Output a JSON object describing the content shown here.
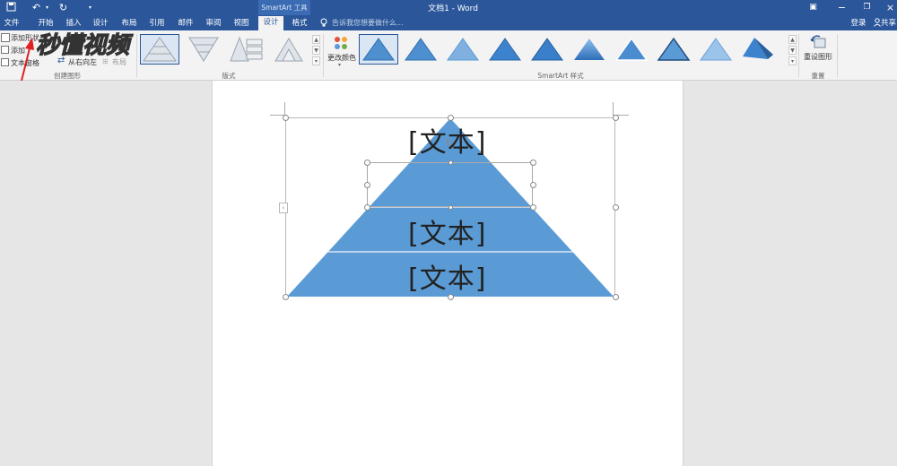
{
  "window": {
    "title": "文档1 - Word",
    "context_tool": "SmartArt 工具",
    "signin": "登录",
    "share": "共享"
  },
  "tabs": [
    "文件",
    "开始",
    "插入",
    "设计",
    "布局",
    "引用",
    "邮件",
    "审阅",
    "视图",
    "设计",
    "格式"
  ],
  "active_tab_index": 9,
  "search": {
    "placeholder": "告诉我您想要做什么..."
  },
  "ribbon": {
    "create_graphic": {
      "label": "创建图形",
      "add_shape": "添加形状",
      "add_bullet": "添加",
      "text_pane": "文本窗格",
      "right_to_left": "从右向左",
      "layout": "布局"
    },
    "layouts": {
      "label": "版式"
    },
    "change_colors": "更改颜色",
    "styles": {
      "label": "SmartArt 样式"
    },
    "reset": {
      "label": "重置",
      "reset_graphic": "重设图形"
    }
  },
  "watermark": "秒懂视频",
  "smartart": {
    "levels": [
      "[文本]",
      "[文本]",
      "[文本]"
    ],
    "fill_color": "#5b9bd5",
    "divider_color": "#dbe7f5"
  },
  "colors": {
    "ribbon_blue": "#2b579a",
    "annotation_arrow": "#e02020"
  }
}
